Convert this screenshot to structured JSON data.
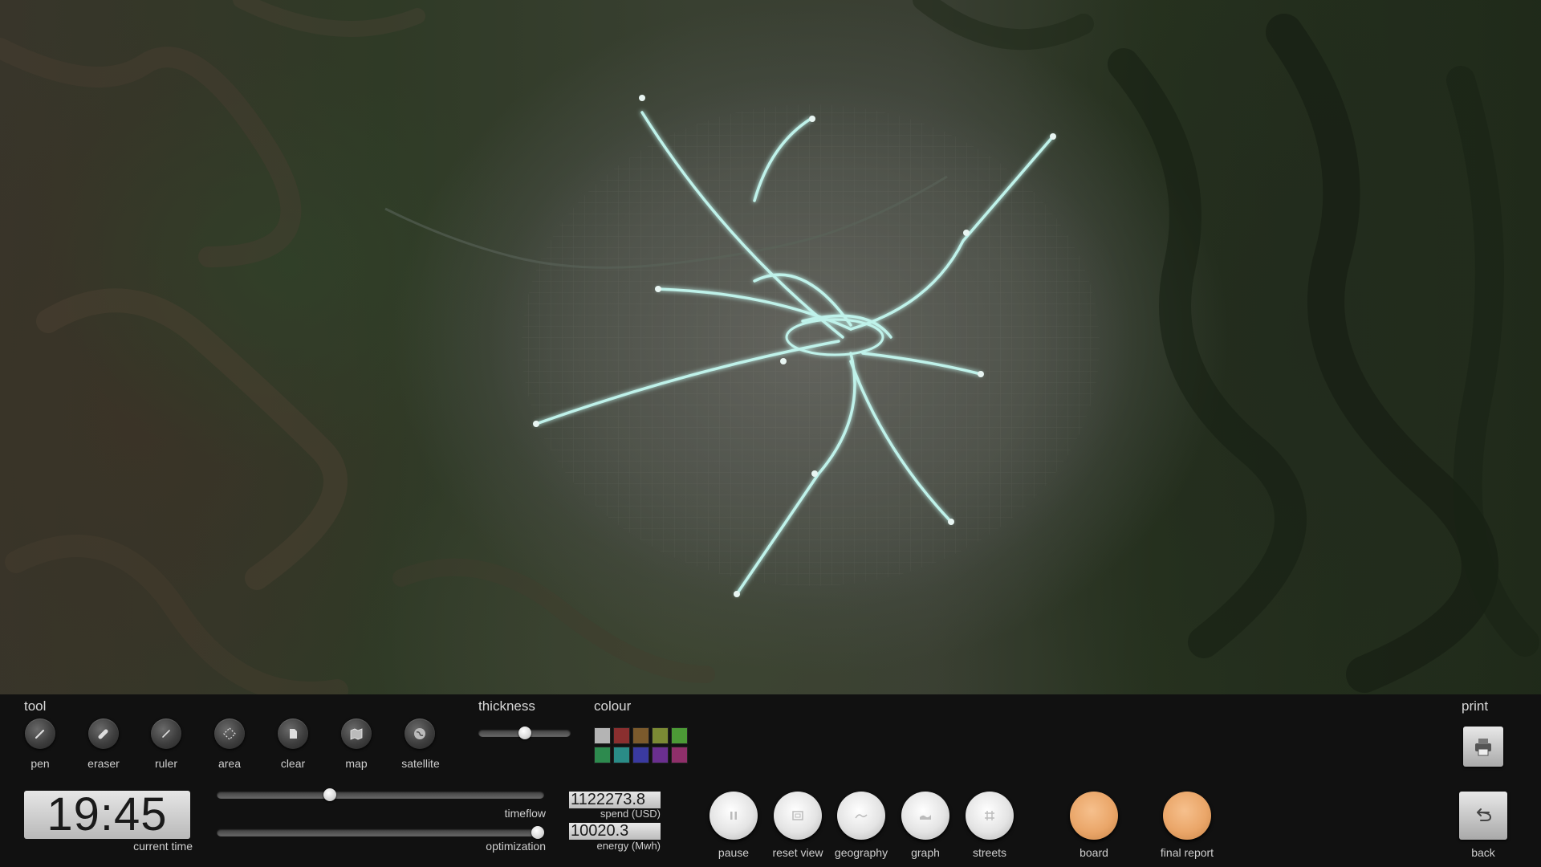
{
  "toolbar": {
    "tool_heading": "tool",
    "tools": [
      {
        "label": "pen",
        "icon": "pen-icon"
      },
      {
        "label": "eraser",
        "icon": "eraser-icon"
      },
      {
        "label": "ruler",
        "icon": "ruler-icon"
      },
      {
        "label": "area",
        "icon": "area-icon"
      },
      {
        "label": "clear",
        "icon": "clear-icon"
      },
      {
        "label": "map",
        "icon": "map-icon"
      },
      {
        "label": "satellite",
        "icon": "satellite-icon"
      }
    ],
    "thickness_heading": "thickness",
    "thickness_level": 0.5,
    "colour_heading": "colour",
    "colours": [
      "#b4b4b4",
      "#8a2f2f",
      "#7b5a2c",
      "#7b8a34",
      "#4c9a36",
      "#2d8a4e",
      "#2a8c87",
      "#3a3aa0",
      "#6a2f8f",
      "#8f2f6a"
    ],
    "print_heading": "print",
    "print_icon": "printer-icon"
  },
  "status": {
    "current_time": "19:45",
    "current_time_label": "current time",
    "timeflow_label": "timeflow",
    "timeflow_level": 0.34,
    "optimization_label": "optimization",
    "optimization_level": 1.0,
    "spend_value": "1122273.8",
    "spend_label": "spend (USD)",
    "energy_value": "10020.3",
    "energy_label": "energy (Mwh)"
  },
  "controls": {
    "pause": {
      "label": "pause",
      "icon": "pause-icon"
    },
    "reset_view": {
      "label": "reset view",
      "icon": "reset-view-icon"
    },
    "geography": {
      "label": "geography",
      "icon": "geography-icon"
    },
    "graph": {
      "label": "graph",
      "icon": "graph-icon"
    },
    "streets": {
      "label": "streets",
      "icon": "streets-icon"
    },
    "board": {
      "label": "board"
    },
    "final_report": {
      "label": "final report"
    },
    "back": {
      "label": "back",
      "icon": "back-arrow-icon"
    }
  },
  "map": {
    "network_color": "#bff2ea",
    "view": "satellite"
  }
}
